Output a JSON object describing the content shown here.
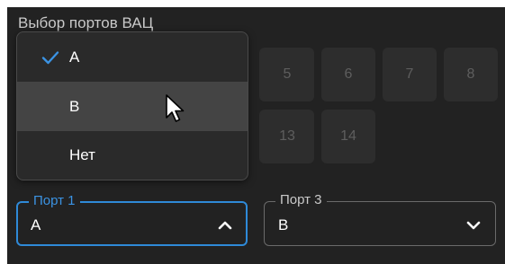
{
  "section": {
    "title": "Выбор портов ВАЦ"
  },
  "port_grid": {
    "buttons": [
      "5",
      "6",
      "7",
      "8",
      "13",
      "14"
    ]
  },
  "dropdown_menu": {
    "items": [
      {
        "label": "A",
        "checked": true
      },
      {
        "label": "B",
        "checked": false,
        "hovered": true
      },
      {
        "label": "Нет",
        "checked": false
      }
    ]
  },
  "port1": {
    "legend": "Порт 1",
    "value": "A",
    "state": "open",
    "accent": "#2f8ad8"
  },
  "port3": {
    "legend": "Порт 3",
    "value": "B",
    "state": "closed"
  },
  "icons": {
    "check": "check-icon",
    "cursor": "mouse-pointer-icon",
    "chevron_up": "chevron-up-icon",
    "chevron_down": "chevron-down-icon"
  }
}
